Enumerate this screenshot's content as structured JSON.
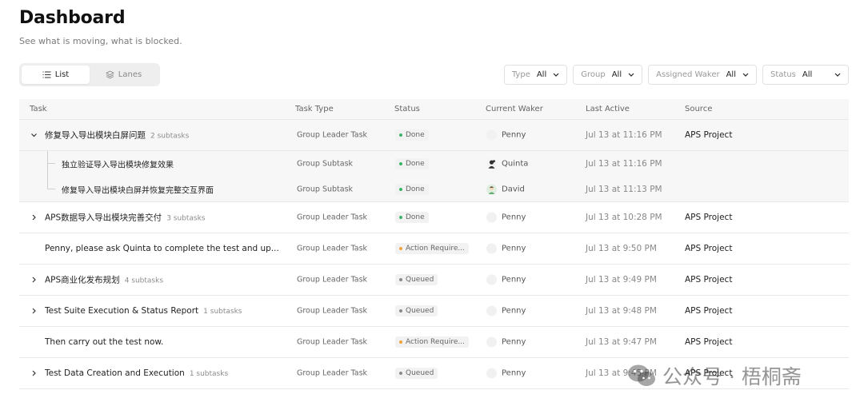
{
  "header": {
    "title": "Dashboard",
    "subtitle": "See what is moving, what is blocked."
  },
  "view_toggle": {
    "list_label": "List",
    "lanes_label": "Lanes",
    "active": "list"
  },
  "filters": {
    "type": {
      "label": "Type",
      "value": "All"
    },
    "group": {
      "label": "Group",
      "value": "All"
    },
    "assigned_waker": {
      "label": "Assigned Waker",
      "value": "All"
    },
    "status": {
      "label": "Status",
      "value": "All"
    }
  },
  "table": {
    "columns": [
      "Task",
      "Task Type",
      "Status",
      "Current Waker",
      "Last Active",
      "Source"
    ],
    "rows": [
      {
        "task": "修复导入导出模块白屏问题",
        "subtasks": "2 subtasks",
        "type": "Group Leader Task",
        "status": "Done",
        "waker": "Penny",
        "last_active": "Jul 13 at 11:16 PM",
        "source": "APS Project",
        "expanded": true,
        "children": [
          {
            "task": "独立验证导入导出模块修复效果",
            "type": "Group Subtask",
            "status": "Done",
            "waker": "Quinta",
            "last_active": "Jul 13 at 11:16 PM",
            "source": ""
          },
          {
            "task": "修复导入导出模块白屏并恢复完整交互界面",
            "type": "Group Subtask",
            "status": "Done",
            "waker": "David",
            "last_active": "Jul 13 at 11:13 PM",
            "source": ""
          }
        ]
      },
      {
        "task": "APS数据导入导出模块完善交付",
        "subtasks": "3 subtasks",
        "type": "Group Leader Task",
        "status": "Done",
        "waker": "Penny",
        "last_active": "Jul 13 at 10:28 PM",
        "source": "APS Project"
      },
      {
        "task": "Penny, please ask Quinta to complete the test and up...",
        "subtasks": "",
        "type": "Group Leader Task",
        "status": "Action Require...",
        "waker": "Penny",
        "last_active": "Jul 13 at 9:50 PM",
        "source": "APS Project"
      },
      {
        "task": "APS商业化发布规划",
        "subtasks": "4 subtasks",
        "type": "Group Leader Task",
        "status": "Queued",
        "waker": "Penny",
        "last_active": "Jul 13 at 9:49 PM",
        "source": "APS Project"
      },
      {
        "task": "Test Suite Execution & Status Report",
        "subtasks": "1 subtasks",
        "type": "Group Leader Task",
        "status": "Queued",
        "waker": "Penny",
        "last_active": "Jul 13 at 9:48 PM",
        "source": "APS Project"
      },
      {
        "task": "Then carry out the test now.",
        "subtasks": "",
        "type": "Group Leader Task",
        "status": "Action Require...",
        "waker": "Penny",
        "last_active": "Jul 13 at 9:47 PM",
        "source": "APS Project"
      },
      {
        "task": "Test Data Creation and Execution",
        "subtasks": "1 subtasks",
        "type": "Group Leader Task",
        "status": "Queued",
        "waker": "Penny",
        "last_active": "Jul 13 at 9:45 PM",
        "source": "APS Project"
      }
    ]
  },
  "status_colors": {
    "Done": "#3bb46a",
    "Queued": "#8a8a8a",
    "Action Require...": "#f0a23b"
  },
  "icons": {
    "list": "list-icon",
    "lanes": "layers-icon",
    "expand": "chevron-right-icon",
    "collapse": "chevron-down-icon",
    "filter": "chevron-down-icon"
  },
  "watermark": {
    "text": "公众号 · 梧桐斋"
  }
}
